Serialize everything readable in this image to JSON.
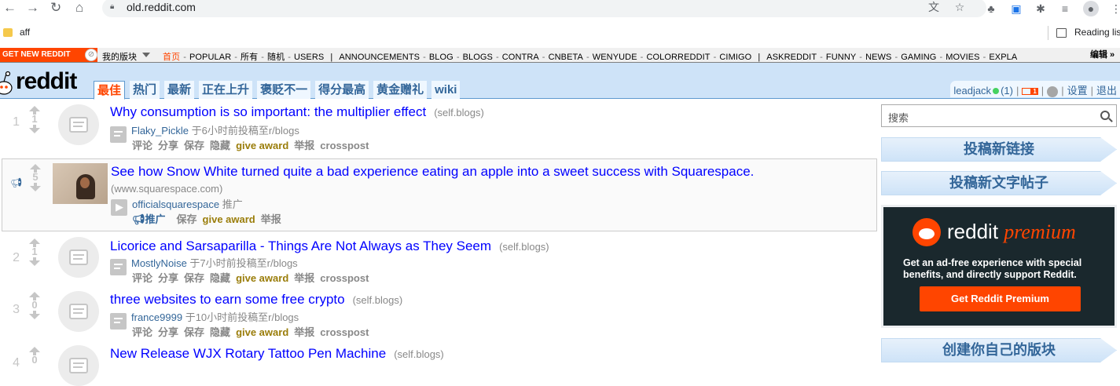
{
  "browser": {
    "url": "old.reddit.com",
    "bookmark": "aff",
    "reading_list": "Reading lis"
  },
  "srbar": {
    "get_new": "GET NEW REDDIT",
    "my_subs": "我的版块",
    "links": [
      "首页",
      "POPULAR",
      "所有",
      "随机",
      "USERS"
    ],
    "links2": [
      "ANNOUNCEMENTS",
      "BLOG",
      "BLOGS",
      "CONTRA",
      "CNBETA",
      "WENYUDE",
      "COLORREDDIT",
      "CIMIGO"
    ],
    "links3": [
      "ASKREDDIT",
      "FUNNY",
      "NEWS",
      "GAMING",
      "MOVIES",
      "EXPLA"
    ],
    "edit": "编辑 »"
  },
  "header": {
    "logo": "reddit",
    "tabs": [
      "最佳",
      "热门",
      "最新",
      "正在上升",
      "褒贬不一",
      "得分最高",
      "黄金赠礼",
      "wiki"
    ],
    "user": "leadjack",
    "karma": "(1)",
    "mail_count": "1",
    "prefs": "设置",
    "logout": "退出"
  },
  "posts": [
    {
      "rank": "1",
      "score": "1",
      "title": "Why consumption is so important: the multiplier effect",
      "domain": "(self.blogs)",
      "author": "Flaky_Pickle",
      "meta": "于6小时前投稿至r/blogs"
    },
    {
      "rank": "2",
      "score": "1",
      "title": "Licorice and Sarsaparilla - Things Are Not Always as They Seem",
      "domain": "(self.blogs)",
      "author": "MostlyNoise",
      "meta": "于7小时前投稿至r/blogs"
    },
    {
      "rank": "3",
      "score": "0",
      "title": "three websites to earn some free crypto",
      "domain": "(self.blogs)",
      "author": "france9999",
      "meta": "于10小时前投稿至r/blogs"
    },
    {
      "rank": "4",
      "score": "0",
      "title": "New Release WJX Rotary Tattoo Pen Machine",
      "domain": "(self.blogs)",
      "author": "",
      "meta": ""
    }
  ],
  "buttons": {
    "comments": "评论",
    "share": "分享",
    "save": "保存",
    "hide": "隐藏",
    "award": "give award",
    "report": "举报",
    "crosspost": "crosspost"
  },
  "promoted": {
    "score": "5",
    "title": "See how Snow White turned quite a bad experience eating an apple into a sweet success with Squarespace.",
    "domain": "(www.squarespace.com)",
    "author": "officialsquarespace",
    "tag": "推广",
    "promote_btn": "推广"
  },
  "sidebar": {
    "search_placeholder": "搜索",
    "submit_link": "投稿新链接",
    "submit_text": "投稿新文字帖子",
    "premium_brand": "reddit",
    "premium_word": "premium",
    "premium_text": "Get an ad-free experience with special benefits, and directly support Reddit.",
    "premium_button": "Get Reddit Premium",
    "create_sub": "创建你自己的版块"
  }
}
